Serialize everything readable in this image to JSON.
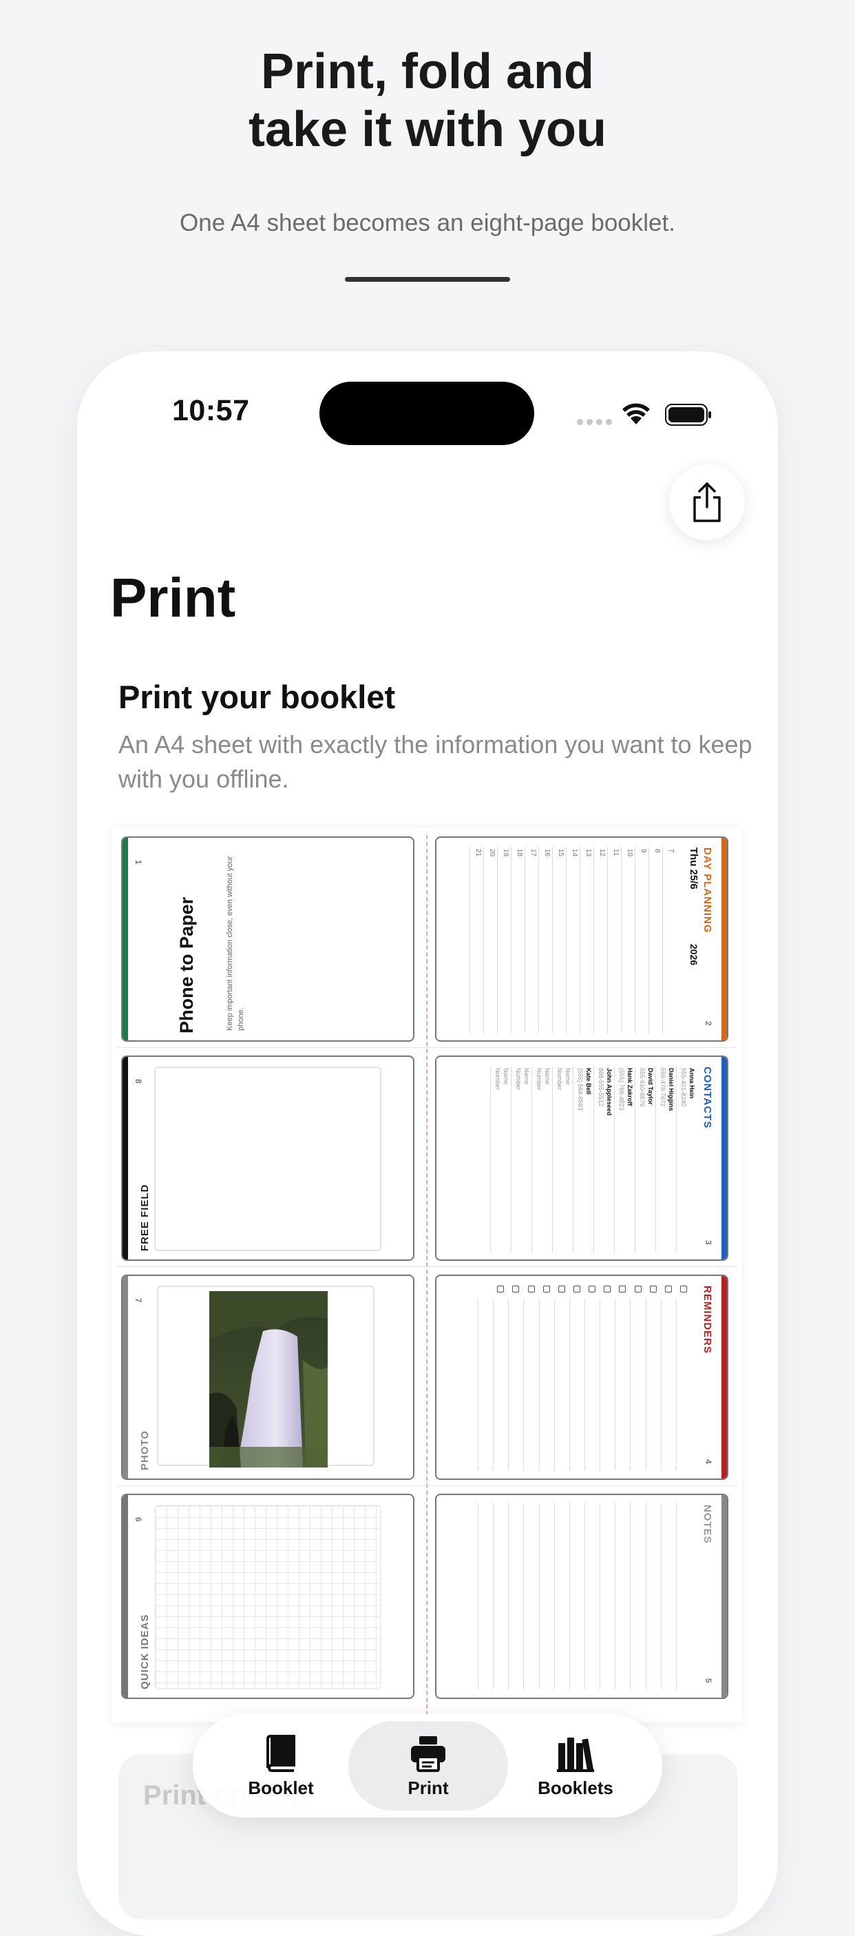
{
  "promo": {
    "title": "Print, fold and\ntake it with you",
    "subtitle": "One A4 sheet becomes an eight-page booklet."
  },
  "status_bar": {
    "time": "10:57"
  },
  "header": {
    "share_icon": "share-icon",
    "title": "Print"
  },
  "section": {
    "title": "Print your booklet",
    "description": "An A4 sheet with exactly the information you want to keep with you offline."
  },
  "booklet": {
    "cover": {
      "page": "1",
      "title": "Phone to Paper",
      "text": "Keep important information close, even without your phone."
    },
    "day_planning": {
      "header": "DAY PLANNING",
      "date": "Thu 25/6",
      "year": "2026",
      "page": "2",
      "hours": [
        "7",
        "8",
        "9",
        "10",
        "11",
        "12",
        "13",
        "14",
        "15",
        "16",
        "17",
        "18",
        "19",
        "20",
        "21"
      ],
      "color": "#d2691e"
    },
    "free_field": {
      "header": "FREE FIELD",
      "page": "8",
      "color": "#111111"
    },
    "contacts": {
      "header": "CONTACTS",
      "page": "3",
      "color": "#1f5fbf",
      "entries": [
        {
          "name": "Anna Hein",
          "phone": "555-401-8240"
        },
        {
          "name": "Daniel Higgins",
          "phone": "555-478-7672"
        },
        {
          "name": "David Taylor",
          "phone": "555-610-6679"
        },
        {
          "name": "Hank Zakroff",
          "phone": "(555) 766-4823"
        },
        {
          "name": "John Appleseed",
          "phone": "888-555-5512"
        },
        {
          "name": "Kate Bell",
          "phone": "(555) 564-8583"
        },
        {
          "name": "Name",
          "phone": "Number"
        },
        {
          "name": "Name",
          "phone": "Number"
        },
        {
          "name": "Name",
          "phone": "Number"
        },
        {
          "name": "Name",
          "phone": "Number"
        }
      ]
    },
    "photo": {
      "header": "PHOTO",
      "page": "7",
      "color": "#888888"
    },
    "reminders": {
      "header": "REMINDERS",
      "page": "4",
      "color": "#b22222"
    },
    "quick_ideas": {
      "header": "QUICK IDEAS",
      "page": "6",
      "color": "#777777"
    },
    "notes": {
      "header": "NOTES",
      "page": "5",
      "color": "#888888"
    }
  },
  "card_below": {
    "title": "Print options"
  },
  "tabbar": {
    "tabs": [
      {
        "label": "Booklet",
        "icon": "book-icon",
        "active": false
      },
      {
        "label": "Print",
        "icon": "printer-icon",
        "active": true
      },
      {
        "label": "Booklets",
        "icon": "library-icon",
        "active": false
      }
    ]
  }
}
